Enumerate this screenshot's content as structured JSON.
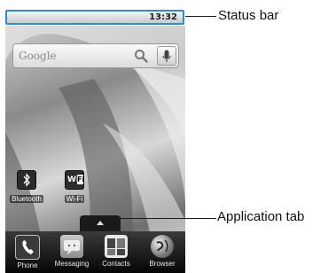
{
  "status_bar": {
    "time": "13:32"
  },
  "search": {
    "placeholder_label": "Google"
  },
  "widgets": [
    {
      "label": "Bluetooth",
      "icon": "bluetooth-icon"
    },
    {
      "label": "Wi-Fi",
      "icon": "wifi-icon"
    }
  ],
  "dock": [
    {
      "label": "Phone",
      "icon": "phone-icon"
    },
    {
      "label": "Messaging",
      "icon": "messaging-icon"
    },
    {
      "label": "Contacts",
      "icon": "contacts-icon"
    },
    {
      "label": "Browser",
      "icon": "browser-icon"
    }
  ],
  "annotations": {
    "status_bar": "Status bar",
    "application_tab": "Application tab"
  },
  "colors": {
    "highlight_border": "#2a8fd1"
  }
}
